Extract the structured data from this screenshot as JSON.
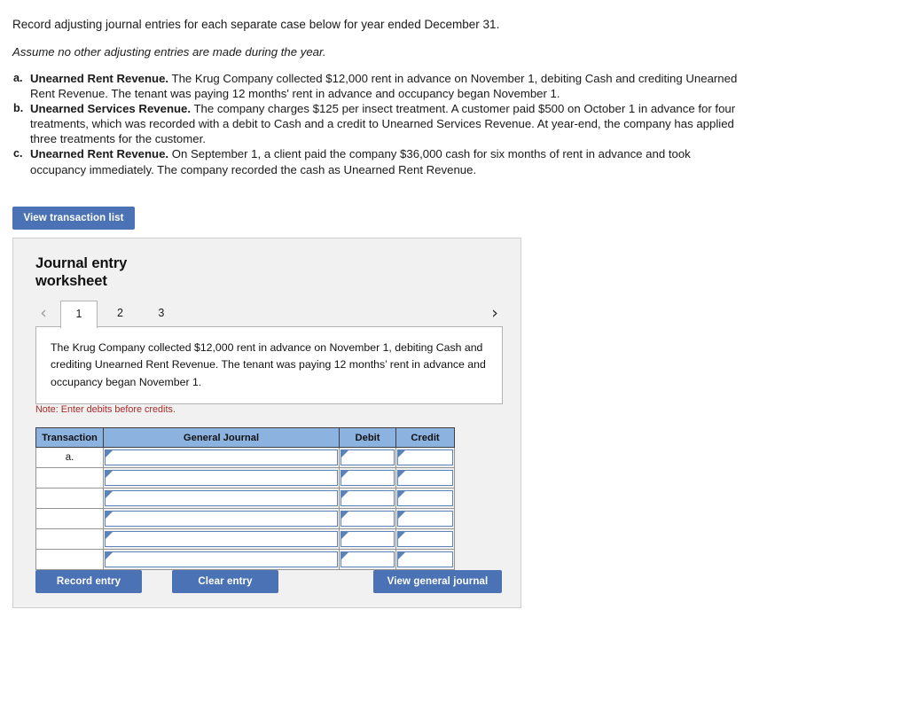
{
  "problem": {
    "lead": "Record adjusting journal entries for each separate case below for year ended December 31.",
    "assumption": "Assume no other adjusting entries are made during the year.",
    "cases": [
      {
        "marker": "a.",
        "term": "Unearned Rent Revenue.",
        "text": " The Krug Company collected $12,000 rent in advance on November 1, debiting Cash and crediting Unearned Rent Revenue. The tenant was paying 12 months' rent in advance and occupancy began November 1."
      },
      {
        "marker": "b.",
        "term": "Unearned Services Revenue.",
        "text": " The company charges $125 per insect treatment. A customer paid $500 on October 1 in advance for four treatments, which was recorded with a debit to Cash and a credit to Unearned Services Revenue. At year-end, the company has applied three treatments for the customer."
      },
      {
        "marker": "c.",
        "term": "Unearned Rent Revenue.",
        "text": " On September 1, a client paid the company $36,000 cash for six months of rent in advance and took occupancy immediately. The company recorded the cash as Unearned Rent Revenue."
      }
    ]
  },
  "toolbar": {
    "view_transaction_list_label": "View transaction list"
  },
  "worksheet": {
    "title": "Journal entry\nworksheet",
    "prev_chevron": "‹",
    "next_chevron": "›",
    "tabs": [
      {
        "label": "1",
        "active": true
      },
      {
        "label": "2",
        "active": false
      },
      {
        "label": "3",
        "active": false
      }
    ],
    "scenario_text": "The Krug Company collected $12,000 rent in advance on November 1, debiting Cash and crediting Unearned Rent Revenue. The tenant was paying 12 months’ rent in advance and occupancy began November 1.",
    "note": "Note: Enter debits before credits.",
    "table": {
      "headers": [
        "Transaction",
        "General Journal",
        "Debit",
        "Credit"
      ],
      "rows": [
        {
          "transaction": "a.",
          "general_journal": "",
          "debit": "",
          "credit": ""
        },
        {
          "transaction": "",
          "general_journal": "",
          "debit": "",
          "credit": ""
        },
        {
          "transaction": "",
          "general_journal": "",
          "debit": "",
          "credit": ""
        },
        {
          "transaction": "",
          "general_journal": "",
          "debit": "",
          "credit": ""
        },
        {
          "transaction": "",
          "general_journal": "",
          "debit": "",
          "credit": ""
        },
        {
          "transaction": "",
          "general_journal": "",
          "debit": "",
          "credit": ""
        }
      ]
    },
    "buttons": {
      "record_entry": "Record entry",
      "clear_entry": "Clear entry",
      "view_general_journal": "View general journal"
    }
  },
  "colors": {
    "button_blue": "#4a72b5",
    "table_header_blue": "#8cb2e0",
    "field_border_blue": "#5b83b8",
    "note_red": "#a82a2a",
    "panel_bg": "#f1f1f1"
  }
}
